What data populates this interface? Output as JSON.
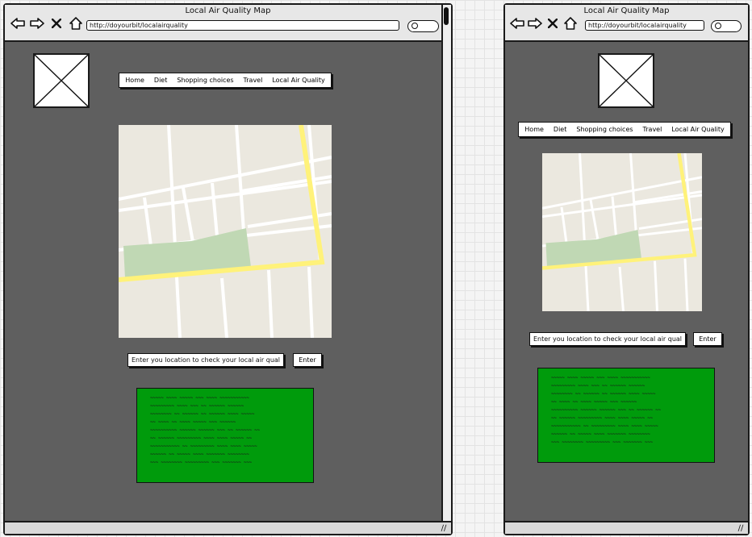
{
  "window_title": "Local Air Quality Map",
  "address_bar": {
    "url": "http://doyourbit/localairquality"
  },
  "nav_menu": {
    "items": [
      {
        "label": "Home"
      },
      {
        "label": "Diet"
      },
      {
        "label": "Shopping choices"
      },
      {
        "label": "Travel"
      },
      {
        "label": "Local Air Quality"
      }
    ]
  },
  "location_form": {
    "input_value": "Enter you location to check your local air quality",
    "button_label": "Enter"
  },
  "result_panel": {
    "color": "#009b0c",
    "lines": [
      "~~~~~ ~~~~ ~~~~~ ~~~ ~~~~ ~~~~~~~~~~~",
      "~~~~~~~~~ ~~~~ ~~~ ~~ ~~~~~~ ~~~~~~",
      "~~~~~~~~ ~~ ~~~~~~ ~~ ~~~~~~ ~~~~ ~~~~~",
      "~~ ~~~~ ~~ ~~~~ ~~~~~ ~~~ ~~~~~~",
      "~~~~~~~~~~ ~~~~~~ ~~~~~~ ~~~ ~~ ~~~~~~ ~~",
      "~~ ~~~~~~ ~~~~~~~~~ ~~~~ ~~~~ ~~~~~ ~~",
      "~~~~~~~~~~~ ~~ ~~~~~~~~~ ~~~~ ~~~~ ~~~~~",
      "~~~~~~ ~~ ~~~~~ ~~~~ ~~~~~~~ ~~~~~~~~",
      "~~~ ~~~~~~~~ ~~~~~~~~~ ~~~ ~~~~~~~ ~~~"
    ]
  },
  "map": {
    "road_color": "#ffffff",
    "highway_color": "#fff27a",
    "park_color": "#c0d8b4",
    "land_color": "#ebe8df"
  },
  "colors": {
    "window_body": "#5f5f5f",
    "title_bar": "#e7e7e7",
    "canvas_bg": "#f4f4f4"
  },
  "icons": {
    "back": "back-arrow-icon",
    "forward": "forward-arrow-icon",
    "stop": "close-icon",
    "home": "home-icon",
    "search": "search-icon",
    "image_placeholder": "image-placeholder-icon",
    "resize": "resize-grip-icon"
  }
}
